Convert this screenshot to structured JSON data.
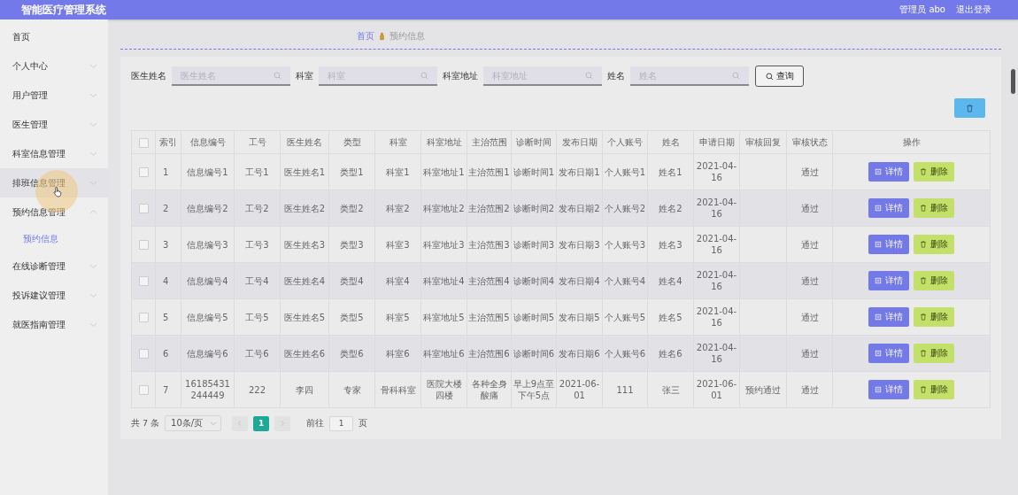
{
  "header": {
    "title": "智能医疗管理系统",
    "user": "管理员 abo",
    "logout": "退出登录"
  },
  "sidebar": {
    "items": [
      {
        "label": "首页",
        "hovered": false
      },
      {
        "label": "个人中心",
        "expanded": false,
        "hovered": false
      },
      {
        "label": "用户管理",
        "expanded": false,
        "hovered": false
      },
      {
        "label": "医生管理",
        "expanded": false,
        "hovered": false
      },
      {
        "label": "科室信息管理",
        "expanded": false,
        "hovered": false
      },
      {
        "label": "排班信息管理",
        "expanded": false,
        "hovered": true
      },
      {
        "label": "预约信息管理",
        "expanded": true,
        "hovered": false,
        "children": [
          {
            "label": "预约信息",
            "selected": true
          }
        ]
      },
      {
        "label": "在线诊断管理",
        "expanded": false,
        "hovered": false
      },
      {
        "label": "投诉建议管理",
        "expanded": false,
        "hovered": false
      },
      {
        "label": "就医指南管理",
        "expanded": false,
        "hovered": false
      }
    ]
  },
  "breadcrumb": [
    "首页",
    "预约信息"
  ],
  "search": {
    "fields": [
      {
        "label": "医生姓名",
        "placeholder": "医生姓名"
      },
      {
        "label": "科室",
        "placeholder": "科室"
      },
      {
        "label": "科室地址",
        "placeholder": "科室地址"
      },
      {
        "label": "姓名",
        "placeholder": "姓名"
      }
    ],
    "button": "查询"
  },
  "table": {
    "columns": [
      "索引",
      "信息编号",
      "工号",
      "医生姓名",
      "类型",
      "科室",
      "科室地址",
      "主治范围",
      "诊断时间",
      "发布日期",
      "个人账号",
      "姓名",
      "申请日期",
      "审核回复",
      "审核状态",
      "操作"
    ],
    "header_checked": false,
    "rows": [
      {
        "checked": false,
        "cells": [
          "1",
          "信息编号1",
          "工号1",
          "医生姓名1",
          "类型1",
          "科室1",
          "科室地址1",
          "主治范围1",
          "诊断时间1",
          "发布日期1",
          "个人账号1",
          "姓名1",
          "2021-04-16",
          "",
          "通过"
        ],
        "actions": [
          "详情",
          "删除"
        ]
      },
      {
        "checked": false,
        "cells": [
          "2",
          "信息编号2",
          "工号2",
          "医生姓名2",
          "类型2",
          "科室2",
          "科室地址2",
          "主治范围2",
          "诊断时间2",
          "发布日期2",
          "个人账号2",
          "姓名2",
          "2021-04-16",
          "",
          "通过"
        ],
        "actions": [
          "详情",
          "删除"
        ]
      },
      {
        "checked": false,
        "cells": [
          "3",
          "信息编号3",
          "工号3",
          "医生姓名3",
          "类型3",
          "科室3",
          "科室地址3",
          "主治范围3",
          "诊断时间3",
          "发布日期3",
          "个人账号3",
          "姓名3",
          "2021-04-16",
          "",
          "通过"
        ],
        "actions": [
          "详情",
          "删除"
        ]
      },
      {
        "checked": false,
        "cells": [
          "4",
          "信息编号4",
          "工号4",
          "医生姓名4",
          "类型4",
          "科室4",
          "科室地址4",
          "主治范围4",
          "诊断时间4",
          "发布日期4",
          "个人账号4",
          "姓名4",
          "2021-04-16",
          "",
          "通过"
        ],
        "actions": [
          "详情",
          "删除"
        ]
      },
      {
        "checked": false,
        "cells": [
          "5",
          "信息编号5",
          "工号5",
          "医生姓名5",
          "类型5",
          "科室5",
          "科室地址5",
          "主治范围5",
          "诊断时间5",
          "发布日期5",
          "个人账号5",
          "姓名5",
          "2021-04-16",
          "",
          "通过"
        ],
        "actions": [
          "详情",
          "删除"
        ]
      },
      {
        "checked": false,
        "cells": [
          "6",
          "信息编号6",
          "工号6",
          "医生姓名6",
          "类型6",
          "科室6",
          "科室地址6",
          "主治范围6",
          "诊断时间6",
          "发布日期6",
          "个人账号6",
          "姓名6",
          "2021-04-16",
          "",
          "通过"
        ],
        "actions": [
          "详情",
          "删除"
        ]
      },
      {
        "checked": false,
        "cells": [
          "7",
          "16185431244449",
          "222",
          "李四",
          "专家",
          "骨科科室",
          "医院大楼四楼",
          "各种全身酸痛",
          "早上9点至下午5点",
          "2021-06-01",
          "111",
          "张三",
          "2021-06-01",
          "预约通过",
          "通过"
        ],
        "actions": [
          "详情",
          "删除"
        ]
      }
    ]
  },
  "pagination": {
    "total": "共 7 条",
    "page_size": "10条/页",
    "pages": [
      {
        "label": "1",
        "selected": true
      }
    ],
    "goto": "前往",
    "goto_value": "1",
    "goto_suffix": "页"
  }
}
